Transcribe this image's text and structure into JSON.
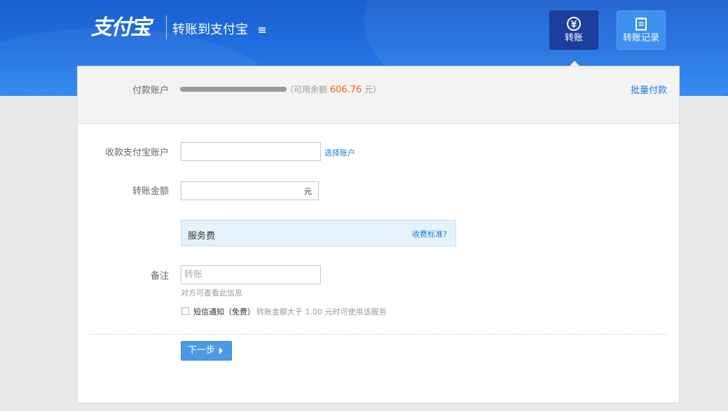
{
  "header": {
    "logo_text": "支付宝",
    "page_title": "转账到支付宝",
    "nav": [
      {
        "label": "转账",
        "icon": "transfer-yuan-icon",
        "active": true
      },
      {
        "label": "转账记录",
        "icon": "clipboard-icon",
        "active": false
      }
    ]
  },
  "payer": {
    "label": "付款账户",
    "account_masked": "",
    "balance_prefix": "（可用余额",
    "balance_amount": "606.76",
    "balance_suffix": "元）",
    "batch_link": "批量付款"
  },
  "form": {
    "recipient_label": "收款支付宝账户",
    "recipient_value": "",
    "choose_account_link": "选择账户",
    "amount_label": "转账金额",
    "amount_value": "",
    "amount_unit": "元",
    "fee_label": "服务费",
    "fee_link": "收费标准?",
    "memo_label": "备注",
    "memo_placeholder": "转账",
    "memo_hint": "对方可查看此信息",
    "sms_label": "短信通知（免费）",
    "sms_hint": "转账金额大于 1.00 元时可使用该服务",
    "sms_checked": false,
    "next_button": "下一步"
  },
  "colors": {
    "brand_blue": "#1f6fe0",
    "active_nav": "#1c3e9c",
    "link": "#1a7bd5",
    "balance": "#f26522",
    "button": "#4a9ae5"
  }
}
